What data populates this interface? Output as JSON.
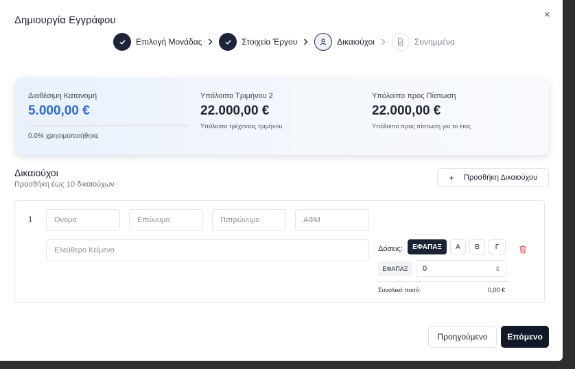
{
  "dialog": {
    "title": "Δημιουργία Εγγράφου",
    "close": "×"
  },
  "stepper": {
    "steps": [
      {
        "label": "Επιλογή Μονάδας",
        "state": "done",
        "icon": "check-icon"
      },
      {
        "label": "Στοιχεία Έργου",
        "state": "done",
        "icon": "check-icon"
      },
      {
        "label": "Δικαιούχοι",
        "state": "active",
        "icon": "user-icon"
      },
      {
        "label": "Συνημμένα",
        "state": "pending",
        "icon": "document-icon"
      }
    ]
  },
  "summary": {
    "allocation": {
      "label": "Διαθέσιμη Κατανομή",
      "amount": "5.000,00 €",
      "used_text": "0.0% χρησιμοποιήθηκε",
      "used_fraction": 0.0
    },
    "quarter": {
      "label": "Υπόλοιπο Τριμήνου 2",
      "amount": "22.000,00 €",
      "sub": "Υπόλοιπο τρέχοντος τριμήνου"
    },
    "credit": {
      "label": "Υπόλοιπο προς Πίστωση",
      "amount": "22.000,00 €",
      "sub": "Υπόλοιπο προς πίστωση για το έτος"
    }
  },
  "beneficiaries": {
    "title": "Δικαιούχοι",
    "subtitle": "Προσθήκη έως 10 δικαιούχων",
    "add_button": "Προσθήκη Δικαιούχου",
    "add_icon": "+",
    "rows": [
      {
        "number": "1",
        "first_name": {
          "value": "",
          "placeholder": "Όνομα"
        },
        "last_name": {
          "value": "",
          "placeholder": "Επώνυμο"
        },
        "father_name": {
          "value": "",
          "placeholder": "Πατρώνυμο"
        },
        "afm": {
          "value": "",
          "placeholder": "ΑΦΜ"
        },
        "free_text": {
          "value": "",
          "placeholder": "Ελεύθερο Κείμενο"
        },
        "installments_label": "Δόσεις:",
        "installment_options": [
          "ΕΦΑΠΑΞ",
          "Α",
          "Β",
          "Γ"
        ],
        "selected_installment": "ΕΦΑΠΑΞ",
        "installment_tag": "ΕΦΑΠΑΞ",
        "amount": "0",
        "currency": "€",
        "total_label": "Συνολικό ποσό:",
        "total_value": "0,00 €"
      }
    ]
  },
  "footer": {
    "previous": "Προηγούμενο",
    "next": "Επόμενο"
  },
  "colors": {
    "accent_blue": "#2d6be0",
    "primary_dark": "#111827",
    "danger_red": "#e05252"
  }
}
